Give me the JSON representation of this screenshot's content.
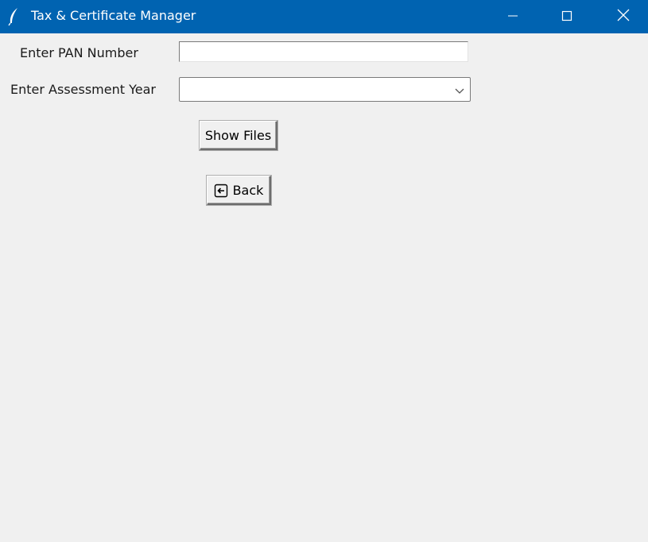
{
  "window": {
    "title": "Tax & Certificate Manager",
    "app_icon": "feather-icon",
    "controls": [
      "minimize-icon",
      "maximize-icon",
      "close-icon"
    ],
    "titlebar_color": "#0063b1"
  },
  "form": {
    "pan_label": "Enter PAN Number",
    "pan_value": "",
    "year_label": "Enter Assessment Year",
    "year_value": ""
  },
  "buttons": {
    "show_files": "Show Files",
    "back": "Back",
    "back_icon": "back-arrow-icon"
  }
}
